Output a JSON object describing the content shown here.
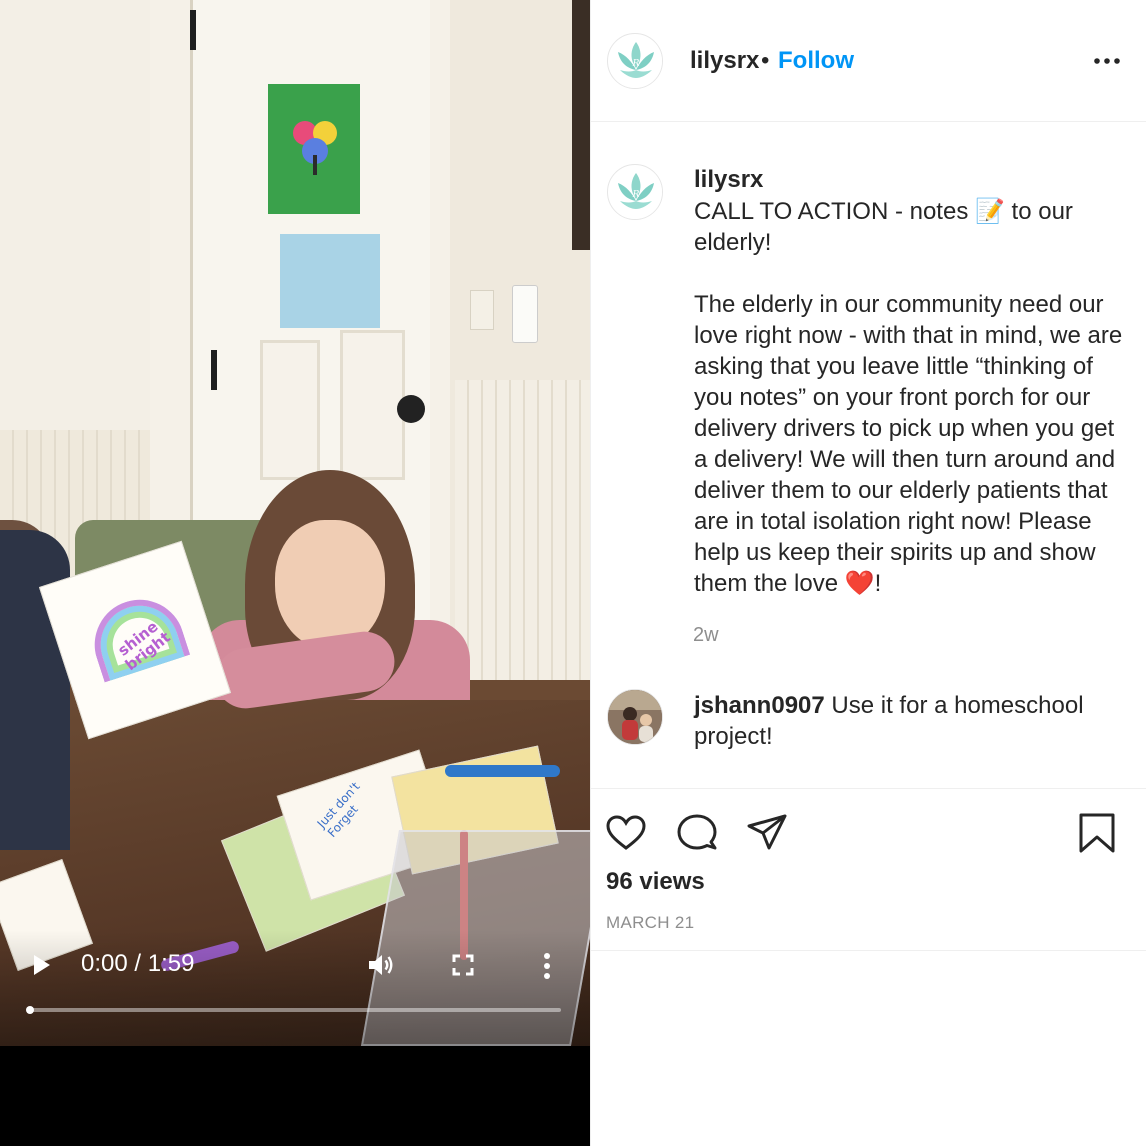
{
  "video": {
    "time_display": "0:00 / 1:59",
    "progress": 0.0,
    "icons": {
      "play": "play-icon",
      "volume": "volume-icon",
      "fullscreen": "fullscreen-icon",
      "more": "vertical-dots-icon"
    },
    "scene_texts": {
      "held_card": "shine bright",
      "table_card": "Just don't Forget"
    }
  },
  "header": {
    "username": "lilysrx",
    "separator": "•",
    "follow_label": "Follow",
    "more_icon": "horizontal-dots-icon"
  },
  "caption": {
    "username": "lilysrx",
    "text": "CALL TO ACTION - notes 📝 to our elderly!\n\nThe elderly in our community need our love right now - with that in mind, we are asking that you leave little “thinking of you notes” on your front porch for our delivery drivers to pick up when you get a delivery! We will then turn around and deliver them to our elderly patients that are in total isolation right now! Please help us keep their spirits up and show them the love ❤️!",
    "age": "2w"
  },
  "comments": [
    {
      "username": "jshann0907",
      "text": "Use it for a homeschool project!"
    }
  ],
  "actions": {
    "icons": [
      "heart-icon",
      "comment-icon",
      "share-icon",
      "bookmark-icon"
    ],
    "views": "96 views",
    "date": "MARCH 21"
  },
  "colors": {
    "link_blue": "#0095f6",
    "text": "#262626",
    "muted": "#8e8e8e",
    "avatar_teal": "#7fcfc4"
  }
}
